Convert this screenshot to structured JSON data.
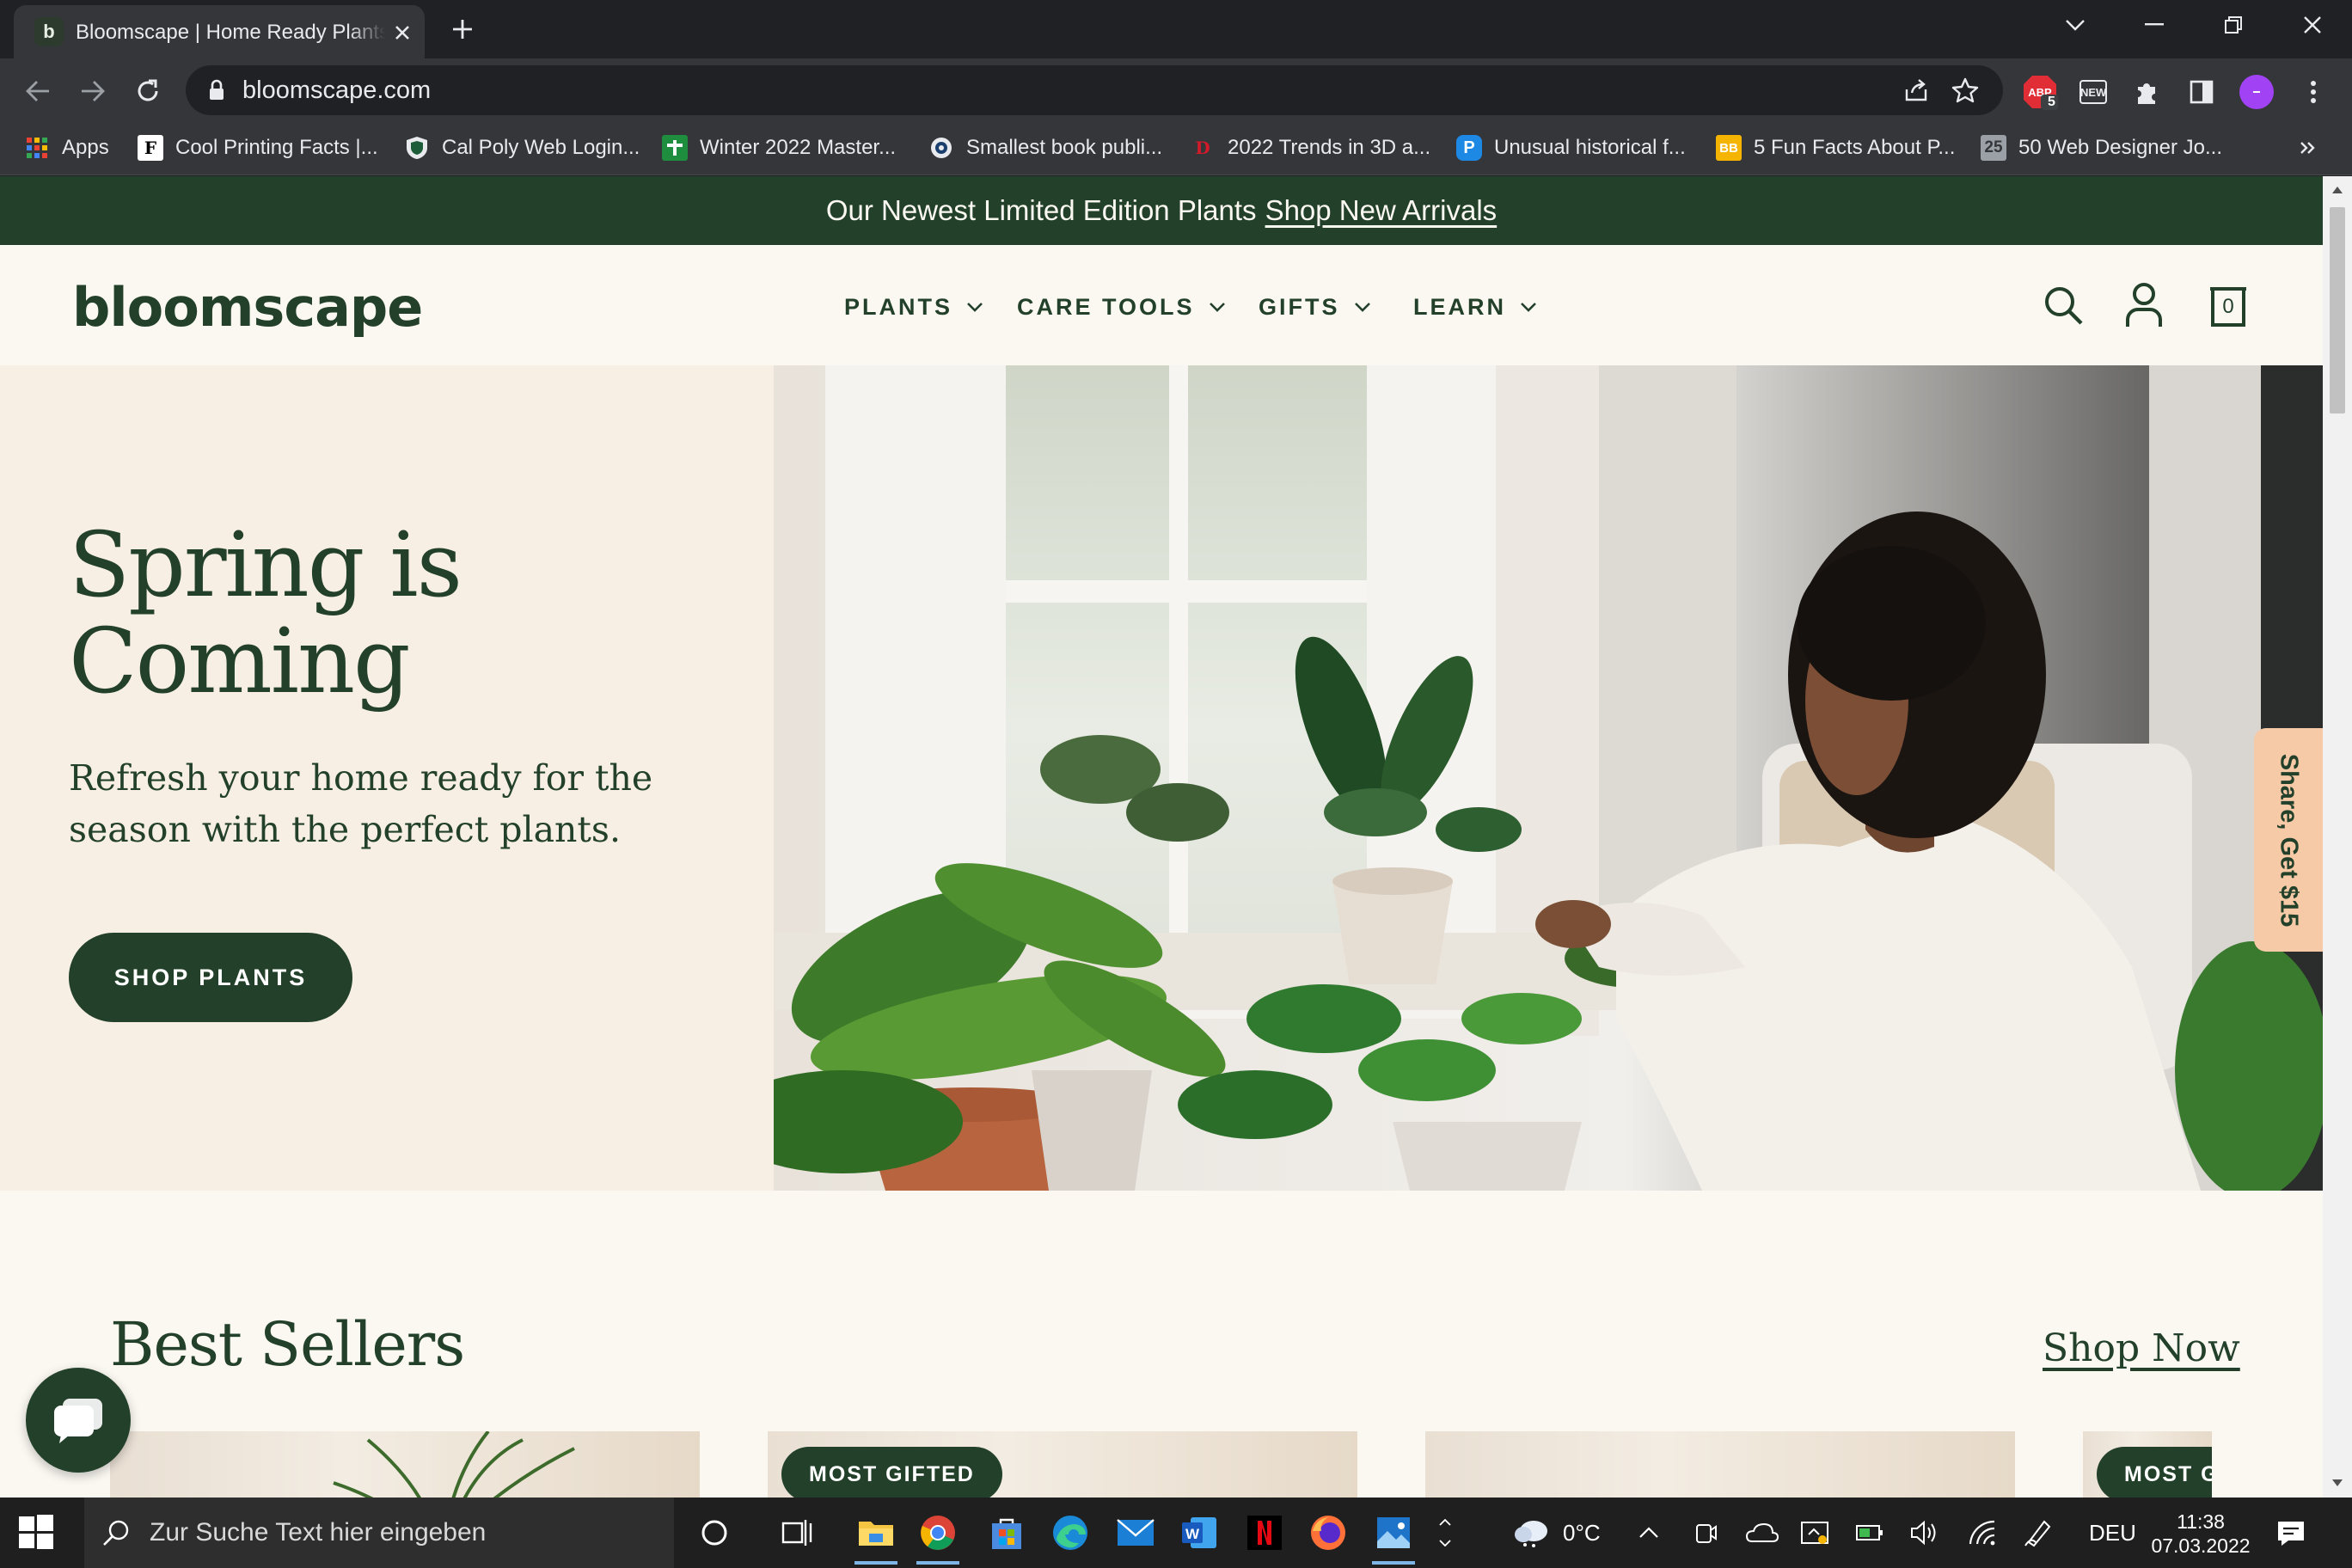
{
  "browser": {
    "tab_title": "Bloomscape | Home Ready Plants",
    "tab_favicon": "b",
    "url": "bloomscape.com",
    "bookmarks": [
      {
        "label": "Apps",
        "icon": "apps-grid-icon"
      },
      {
        "label": "Cool Printing Facts |...",
        "icon": "F"
      },
      {
        "label": "Cal Poly Web Login...",
        "icon": "shield-icon"
      },
      {
        "label": "Winter 2022 Master...",
        "icon": "plus-icon"
      },
      {
        "label": "Smallest book publi...",
        "icon": "globe-icon"
      },
      {
        "label": "2022 Trends in 3D a...",
        "icon": "D"
      },
      {
        "label": "Unusual historical f...",
        "icon": "P"
      },
      {
        "label": "5 Fun Facts About P...",
        "icon": "BB"
      },
      {
        "label": "50 Web Designer Jo...",
        "icon": "25"
      }
    ],
    "extensions": {
      "adblock_badge": "5",
      "new_badge": "NEW"
    }
  },
  "site": {
    "promo_text": "Our Newest Limited Edition Plants",
    "promo_link": "Shop New Arrivals",
    "logo": "bloomscape",
    "nav": [
      "PLANTS",
      "CARE TOOLS",
      "GIFTS",
      "LEARN"
    ],
    "cart_count": "0",
    "hero": {
      "title_line1": "Spring is",
      "title_line2": "Coming",
      "subtitle": "Refresh your home ready for the season with the perfect plants.",
      "cta": "SHOP PLANTS"
    },
    "share_tab": "Share, Get $15",
    "best_sellers": {
      "title": "Best Sellers",
      "link": "Shop Now",
      "badges": [
        "MOST GIFTED",
        "MOST GI"
      ]
    }
  },
  "taskbar": {
    "search_placeholder": "Zur Suche Text hier eingeben",
    "weather": "0°C",
    "language": "DEU",
    "time": "11:38",
    "date": "07.03.2022"
  },
  "colors": {
    "brand_green": "#22402a",
    "hero_bg": "#f7efe3",
    "page_bg": "#fbf8f2",
    "share_tab": "#f6c9a7"
  }
}
